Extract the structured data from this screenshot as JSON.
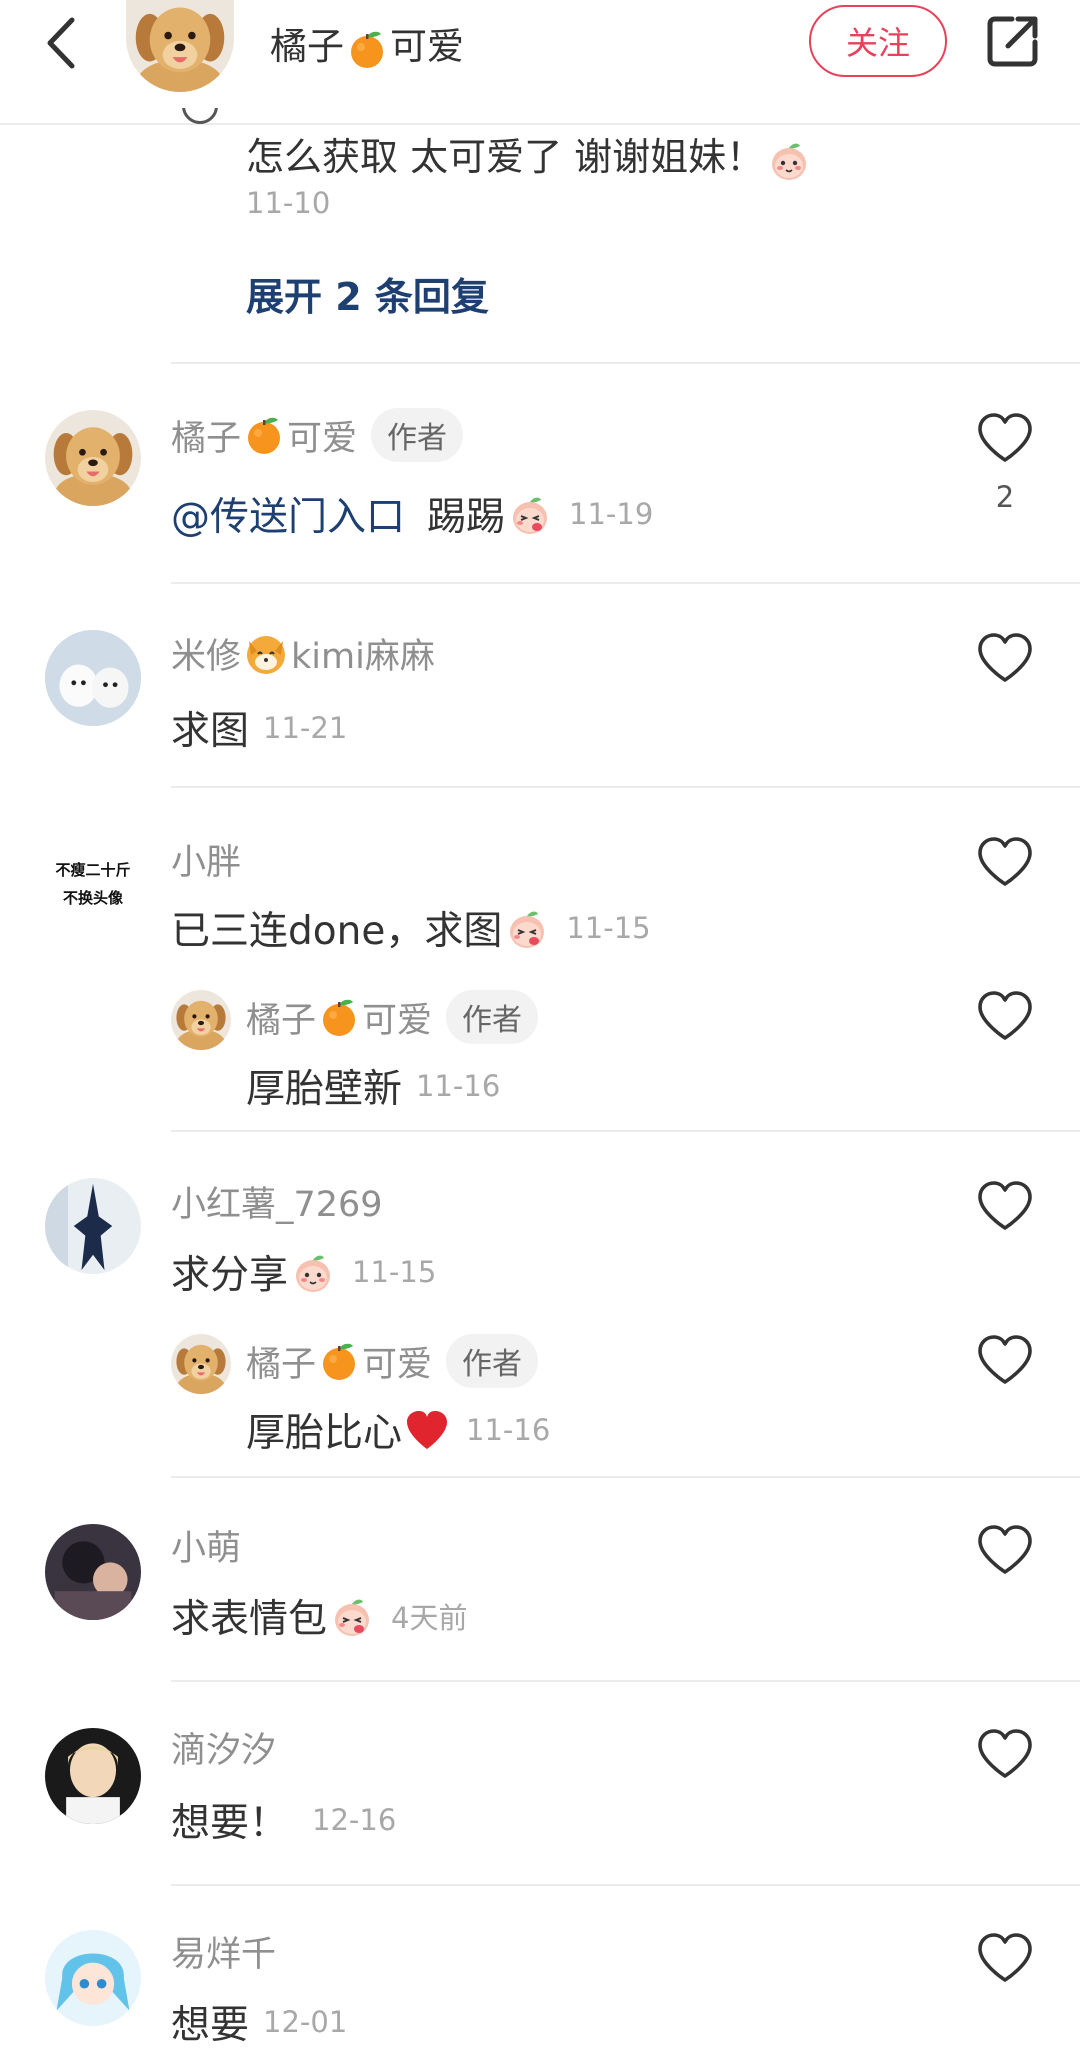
{
  "header": {
    "title_prefix": "橘子",
    "title_suffix": "可爱",
    "follow_label": "关注"
  },
  "top_reply": {
    "text": "怎么获取 太可爱了 谢谢姐妹！",
    "date": "11-10",
    "expand_label": "展开 2 条回复"
  },
  "comments": [
    {
      "user_prefix": "橘子",
      "user_suffix": "可爱",
      "author_tag": "作者",
      "mention": "@传送门入口",
      "text": "踢踢",
      "date": "11-19",
      "likes": "2"
    },
    {
      "user_prefix": "米修",
      "user_suffix": "kimi麻麻",
      "text": "求图",
      "date": "11-21"
    },
    {
      "user": "小胖",
      "avatar_line1": "不瘦二十斤",
      "avatar_line2": "不换头像",
      "text": "已三连done，求图",
      "date": "11-15",
      "reply": {
        "user_prefix": "橘子",
        "user_suffix": "可爱",
        "author_tag": "作者",
        "text": "厚胎壁新",
        "date": "11-16"
      }
    },
    {
      "user": "小红薯_7269",
      "text": "求分享",
      "date": "11-15",
      "reply": {
        "user_prefix": "橘子",
        "user_suffix": "可爱",
        "author_tag": "作者",
        "text": "厚胎比心",
        "date": "11-16"
      }
    },
    {
      "user": "小萌",
      "text": "求表情包",
      "date": "4天前"
    },
    {
      "user": "滴汐汐",
      "text": "想要！",
      "date": "12-16"
    },
    {
      "user": "易烊千",
      "text": "想要",
      "date": "12-01"
    }
  ],
  "colors": {
    "accent": "#e8415a",
    "link": "#1d3f72",
    "muted": "#a8a8a8",
    "username": "#8f8f8f"
  },
  "icons": [
    "back-arrow-icon",
    "share-icon",
    "heart-outline-icon",
    "orange-emoji",
    "peach-emoji",
    "shy-peach-emoji",
    "red-heart-emoji",
    "dog-emoji"
  ]
}
